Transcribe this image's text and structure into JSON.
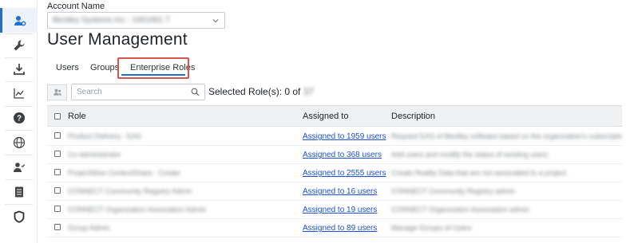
{
  "sidebar": {
    "items": [
      {
        "icon": "user-settings-icon",
        "active": true
      },
      {
        "icon": "wrench-icon",
        "active": false
      },
      {
        "icon": "download-icon",
        "active": false
      },
      {
        "icon": "line-chart-icon",
        "active": false
      },
      {
        "icon": "help-icon",
        "active": false
      },
      {
        "icon": "globe-icon",
        "active": false
      },
      {
        "icon": "user-check-icon",
        "active": false
      },
      {
        "icon": "document-icon",
        "active": false
      },
      {
        "icon": "shield-icon",
        "active": false
      }
    ],
    "active_color": "#1d6fd1"
  },
  "account": {
    "label": "Account Name",
    "value": "Bentley Systems Inc - 1001001 T"
  },
  "page": {
    "title": "User Management"
  },
  "tabs": [
    {
      "label": "Users",
      "active": false
    },
    {
      "label": "Groups",
      "active": false
    },
    {
      "label": "Enterprise Roles",
      "active": true
    }
  ],
  "toolbar": {
    "search_placeholder": "Search",
    "selected_label": "Selected Role(s): 0 of",
    "selected_total": "37"
  },
  "table": {
    "columns": {
      "role": "Role",
      "assigned": "Assigned to",
      "description": "Description"
    },
    "rows": [
      {
        "role": "Product Delivery - EAS",
        "assigned": "Assigned to 1959 users",
        "description": "Request EAS of Bentley software based on the organization's subscription a"
      },
      {
        "role": "Co-administrator",
        "assigned": "Assigned to 368 users",
        "description": "Add users and modify the status of existing users"
      },
      {
        "role": "ProjectWise ContextShare - Create",
        "assigned": "Assigned to 2555 users",
        "description": "Create Reality Data that are not associated to a project"
      },
      {
        "role": "CONNECT Community Registry Admin",
        "assigned": "Assigned to 16 users",
        "description": "CONNECT Community Registry admin"
      },
      {
        "role": "CONNECT Organization Association Admin",
        "assigned": "Assigned to 19 users",
        "description": "CONNECT Organization Association admin"
      },
      {
        "role": "Group Admin",
        "assigned": "Assigned to 89 users",
        "description": "Manage Groups of Users"
      }
    ]
  },
  "colors": {
    "link": "#1d4fd8",
    "highlight_box": "#d9534f",
    "header_bg": "#eef0f2"
  }
}
